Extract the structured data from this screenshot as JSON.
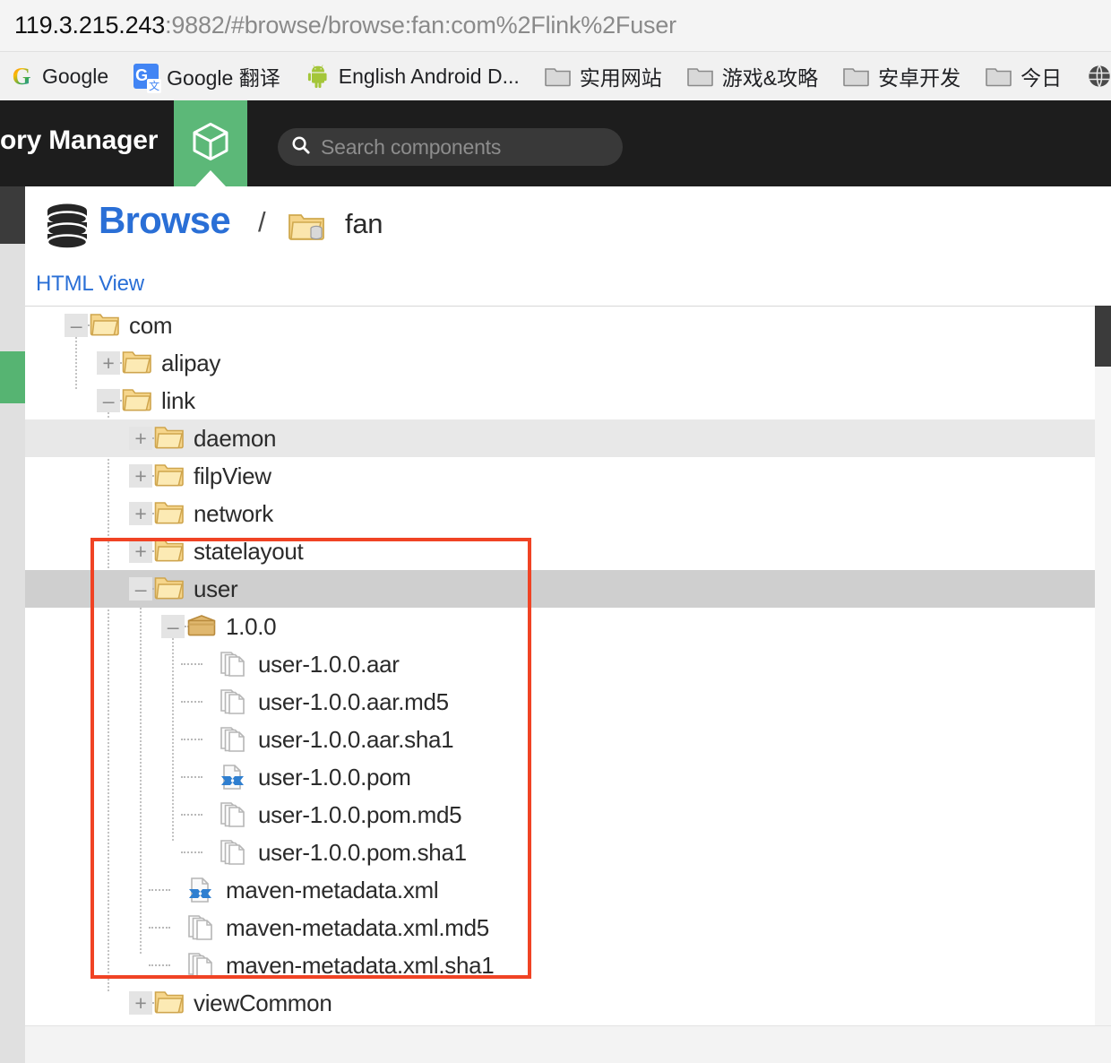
{
  "browser": {
    "url_host": "119.3.215.243",
    "url_rest": ":9882/#browse/browse:fan:com%2Flink%2Fuser",
    "bookmarks": [
      {
        "label": "Google",
        "icon": "google-icon"
      },
      {
        "label": "Google 翻译",
        "icon": "google-translate-icon"
      },
      {
        "label": "English Android D...",
        "icon": "android-icon"
      },
      {
        "label": "实用网站",
        "icon": "folder-icon"
      },
      {
        "label": "游戏&攻略",
        "icon": "folder-icon"
      },
      {
        "label": "安卓开发",
        "icon": "folder-icon"
      },
      {
        "label": "今日",
        "icon": "folder-icon"
      },
      {
        "label": "",
        "icon": "globe-icon"
      }
    ]
  },
  "header": {
    "app_title": "ory Manager",
    "browse_tab_icon": "cube-icon",
    "search_placeholder": "Search components",
    "search_value": "",
    "search_icon": "search-icon",
    "accent_green": "#5cb878",
    "header_bg": "#1d1d1d"
  },
  "page": {
    "title": "Browse",
    "title_icon": "database-icon",
    "breadcrumb_separator": "/",
    "repository_icon": "repository-folder-icon",
    "repository_name": "fan",
    "html_view_link": "HTML View",
    "title_color": "#2a6fd6"
  },
  "tree": {
    "nodes": [
      {
        "label": "com",
        "indent": 0,
        "toggle": "minus",
        "icon": "folder-icon",
        "highlight": "none"
      },
      {
        "label": "alipay",
        "indent": 1,
        "toggle": "plus",
        "icon": "folder-icon",
        "highlight": "none"
      },
      {
        "label": "link",
        "indent": 1,
        "toggle": "minus",
        "icon": "folder-icon",
        "highlight": "none"
      },
      {
        "label": "daemon",
        "indent": 2,
        "toggle": "plus",
        "icon": "folder-icon",
        "highlight": "light"
      },
      {
        "label": "filpView",
        "indent": 2,
        "toggle": "plus",
        "icon": "folder-icon",
        "highlight": "none"
      },
      {
        "label": "network",
        "indent": 2,
        "toggle": "plus",
        "icon": "folder-icon",
        "highlight": "none"
      },
      {
        "label": "statelayout",
        "indent": 2,
        "toggle": "plus",
        "icon": "folder-icon",
        "highlight": "none"
      },
      {
        "label": "user",
        "indent": 2,
        "toggle": "minus",
        "icon": "folder-icon",
        "highlight": "dark"
      },
      {
        "label": "1.0.0",
        "indent": 3,
        "toggle": "minus",
        "icon": "package-icon",
        "highlight": "none"
      },
      {
        "label": "user-1.0.0.aar",
        "indent": 4,
        "toggle": "leaf",
        "icon": "file-icon",
        "highlight": "none"
      },
      {
        "label": "user-1.0.0.aar.md5",
        "indent": 4,
        "toggle": "leaf",
        "icon": "file-icon",
        "highlight": "none"
      },
      {
        "label": "user-1.0.0.aar.sha1",
        "indent": 4,
        "toggle": "leaf",
        "icon": "file-icon",
        "highlight": "none"
      },
      {
        "label": "user-1.0.0.pom",
        "indent": 4,
        "toggle": "leaf",
        "icon": "xml-file-icon",
        "highlight": "none"
      },
      {
        "label": "user-1.0.0.pom.md5",
        "indent": 4,
        "toggle": "leaf",
        "icon": "file-icon",
        "highlight": "none"
      },
      {
        "label": "user-1.0.0.pom.sha1",
        "indent": 4,
        "toggle": "leaf",
        "icon": "file-icon",
        "highlight": "none"
      },
      {
        "label": "maven-metadata.xml",
        "indent": 3,
        "toggle": "leaf",
        "icon": "xml-file-icon",
        "highlight": "none"
      },
      {
        "label": "maven-metadata.xml.md5",
        "indent": 3,
        "toggle": "leaf",
        "icon": "file-icon",
        "highlight": "none"
      },
      {
        "label": "maven-metadata.xml.sha1",
        "indent": 3,
        "toggle": "leaf",
        "icon": "file-icon",
        "highlight": "none"
      },
      {
        "label": "viewCommon",
        "indent": 2,
        "toggle": "plus",
        "icon": "folder-icon",
        "highlight": "none"
      }
    ],
    "toggle_plus": "+",
    "toggle_minus": "–",
    "annotation_color": "#f04324"
  }
}
